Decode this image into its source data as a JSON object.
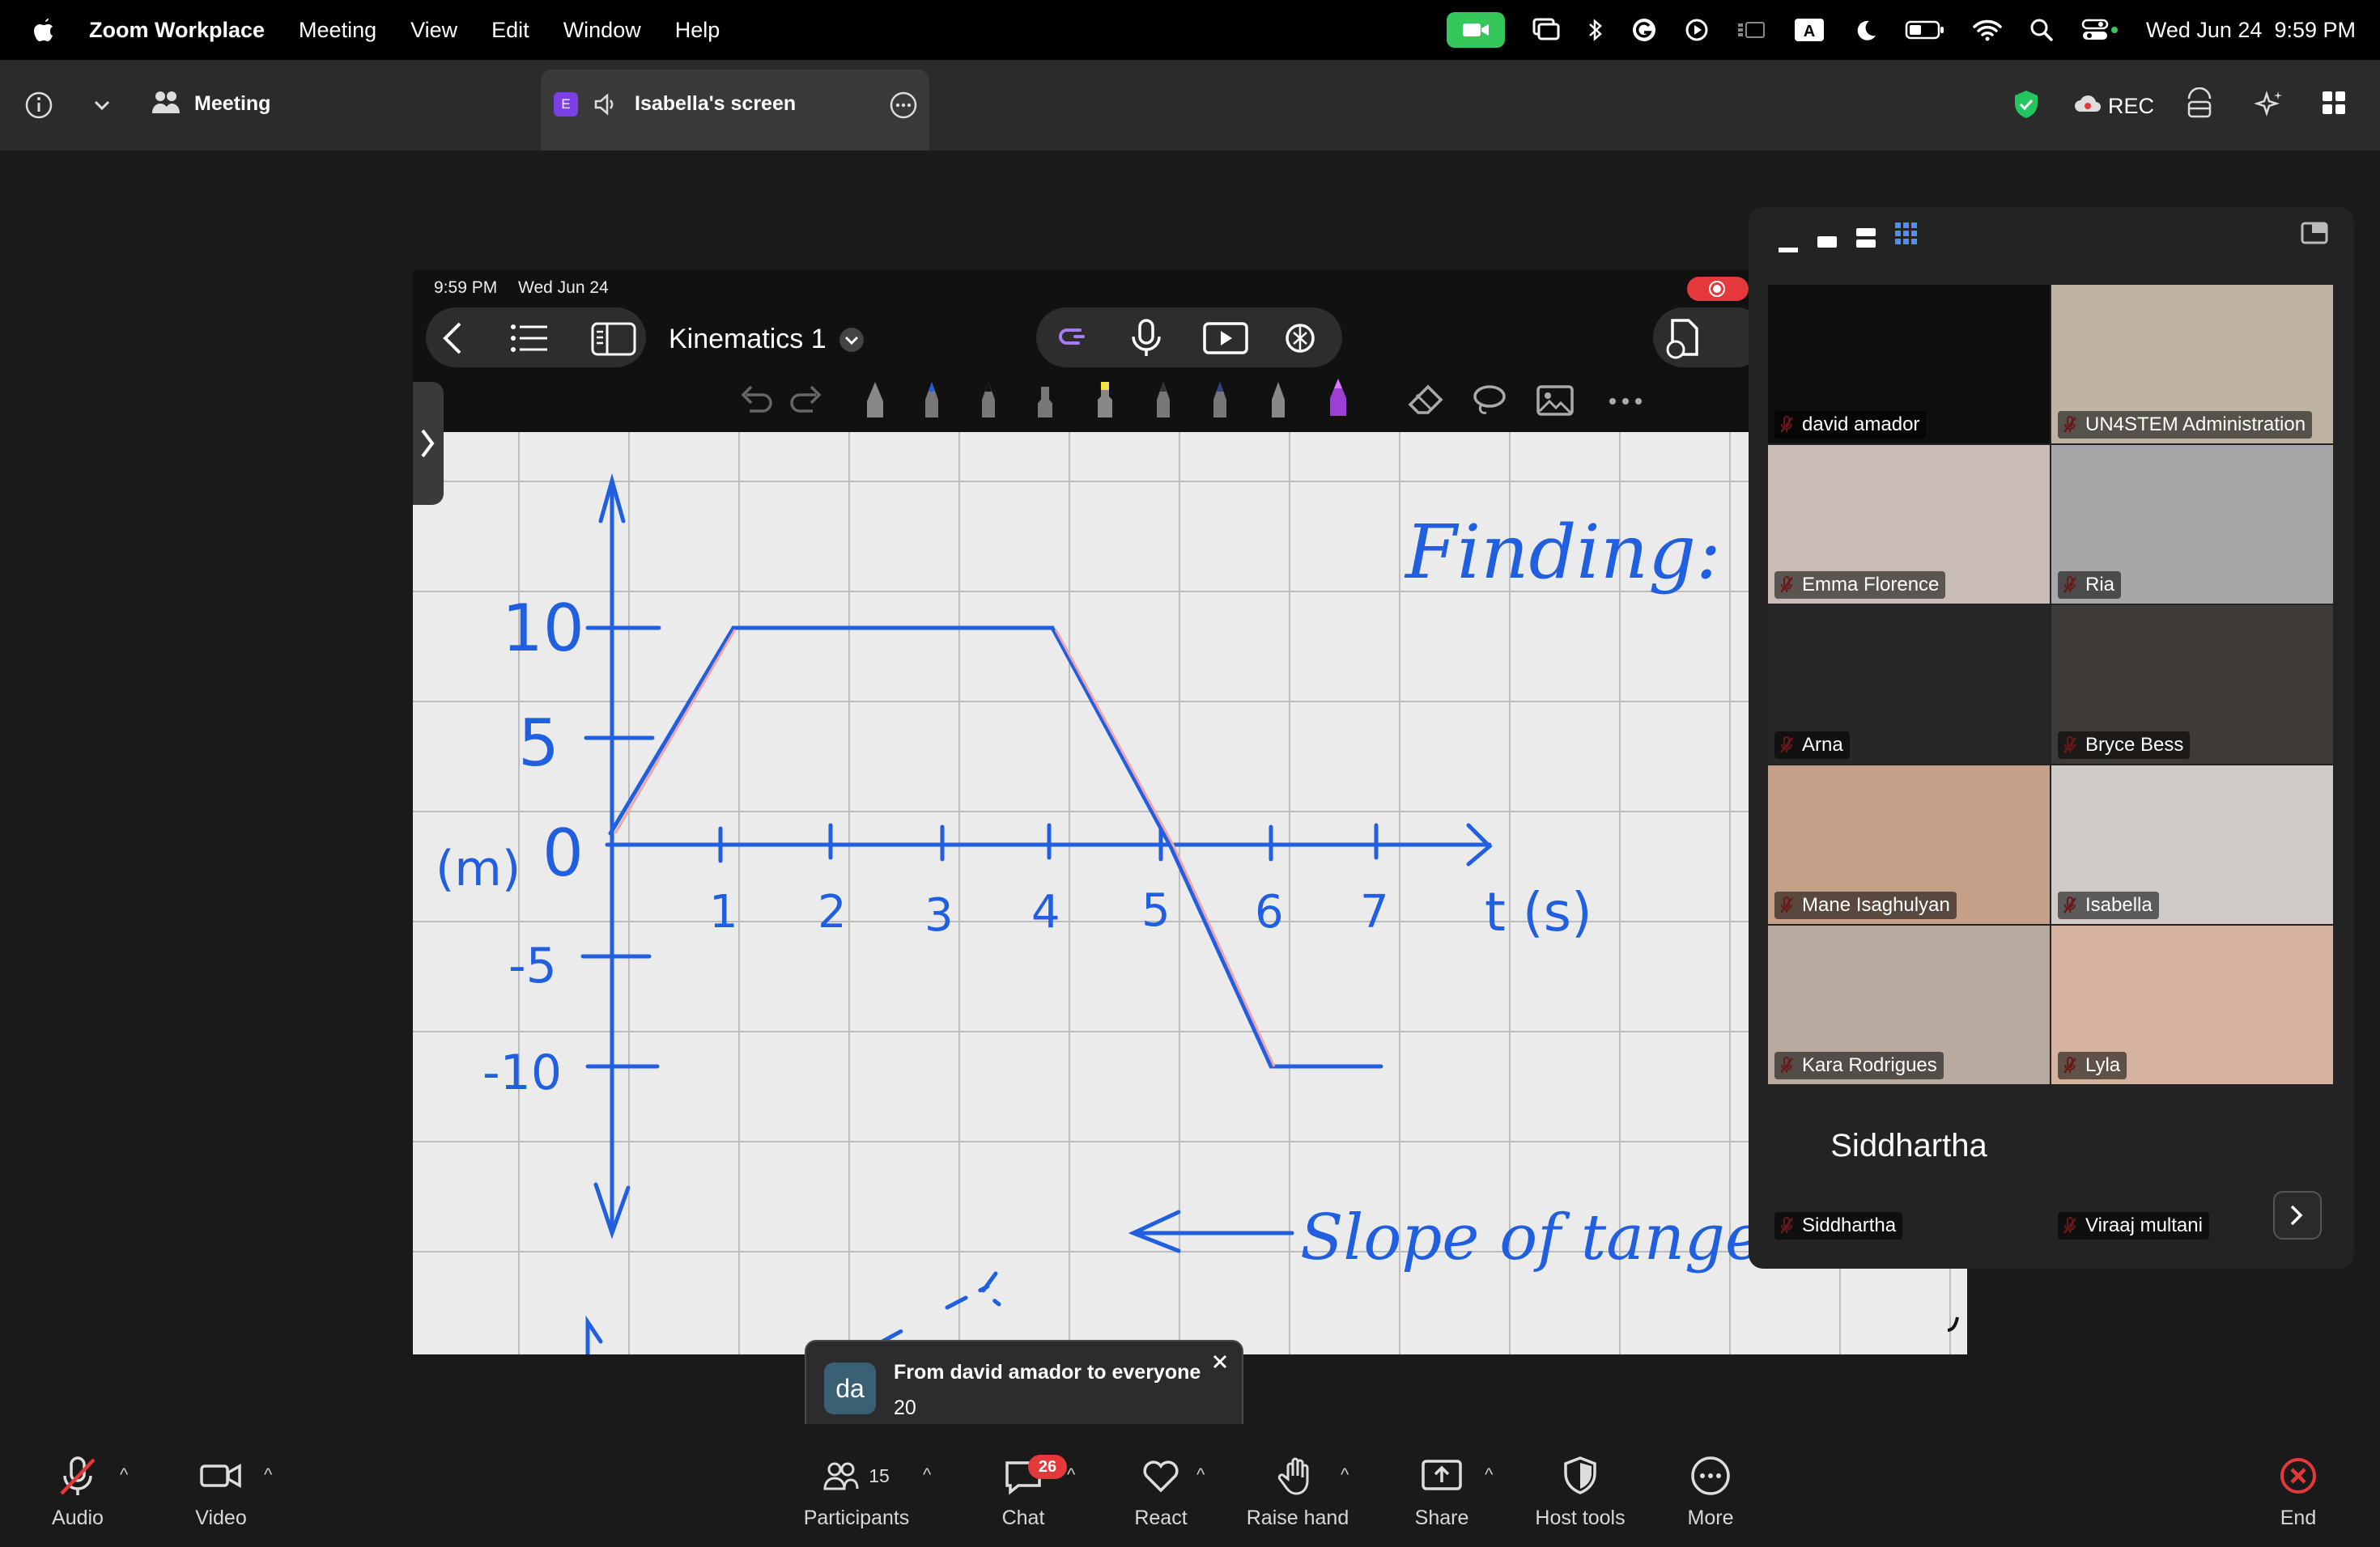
{
  "menubar": {
    "app": "Zoom Workplace",
    "items": [
      "Meeting",
      "View",
      "Edit",
      "Window",
      "Help"
    ],
    "datetime": "Wed Jun 24  9:59 PM"
  },
  "topbar": {
    "meeting_label": "Meeting",
    "tab_badge": "E",
    "tab_label": "Isabella's screen",
    "rec_label": "REC"
  },
  "ipad": {
    "status_time": "9:59 PM",
    "status_date": "Wed Jun 24",
    "notebook_title": "Kinematics 1"
  },
  "whiteboard": {
    "heading": "Finding:",
    "annotation": "Slope of tangen",
    "y_ticks": [
      "10",
      "5",
      "0",
      "-5",
      "-10"
    ],
    "x_ticks": [
      "1",
      "2",
      "3",
      "4",
      "5",
      "6",
      "7"
    ],
    "x_axis_label": "t (s)",
    "y_axis_label": "(m)"
  },
  "gallery": {
    "participants": [
      {
        "name": "david amador",
        "bg": "#0e0e0e"
      },
      {
        "name": "UN4STEM Administration",
        "bg": "#bfb3a4"
      },
      {
        "name": "Emma Florence",
        "bg": "#c9bcb6"
      },
      {
        "name": "Ria",
        "bg": "#a8a6a8"
      },
      {
        "name": "Arna",
        "bg": "#272727"
      },
      {
        "name": "Bryce Bess",
        "bg": "#3e3a37"
      },
      {
        "name": "Mane Isaghulyan",
        "bg": "#c5a088"
      },
      {
        "name": "Isabella",
        "bg": "#cfcbc8"
      },
      {
        "name": "Kara Rodrigues",
        "bg": "#b8aa9e"
      },
      {
        "name": "Lyla",
        "bg": "#d6b3a0"
      },
      {
        "name": "Siddhartha",
        "bg": "#232323",
        "display": "Siddhartha"
      },
      {
        "name": "Viraaj multani",
        "bg": "#232323"
      }
    ]
  },
  "toast": {
    "avatar": "da",
    "title": "From david amador to everyone",
    "message": "20"
  },
  "toolbar": {
    "audio": "Audio",
    "video": "Video",
    "participants": "Participants",
    "participants_count": "15",
    "chat": "Chat",
    "chat_badge": "26",
    "react": "React",
    "raise_hand": "Raise hand",
    "share": "Share",
    "host_tools": "Host tools",
    "more": "More",
    "end": "End"
  },
  "colors": {
    "ink_blue": "#1f5fe0",
    "accent_red": "#e5383b",
    "mute_red": "#e5383b",
    "green": "#35c759"
  }
}
